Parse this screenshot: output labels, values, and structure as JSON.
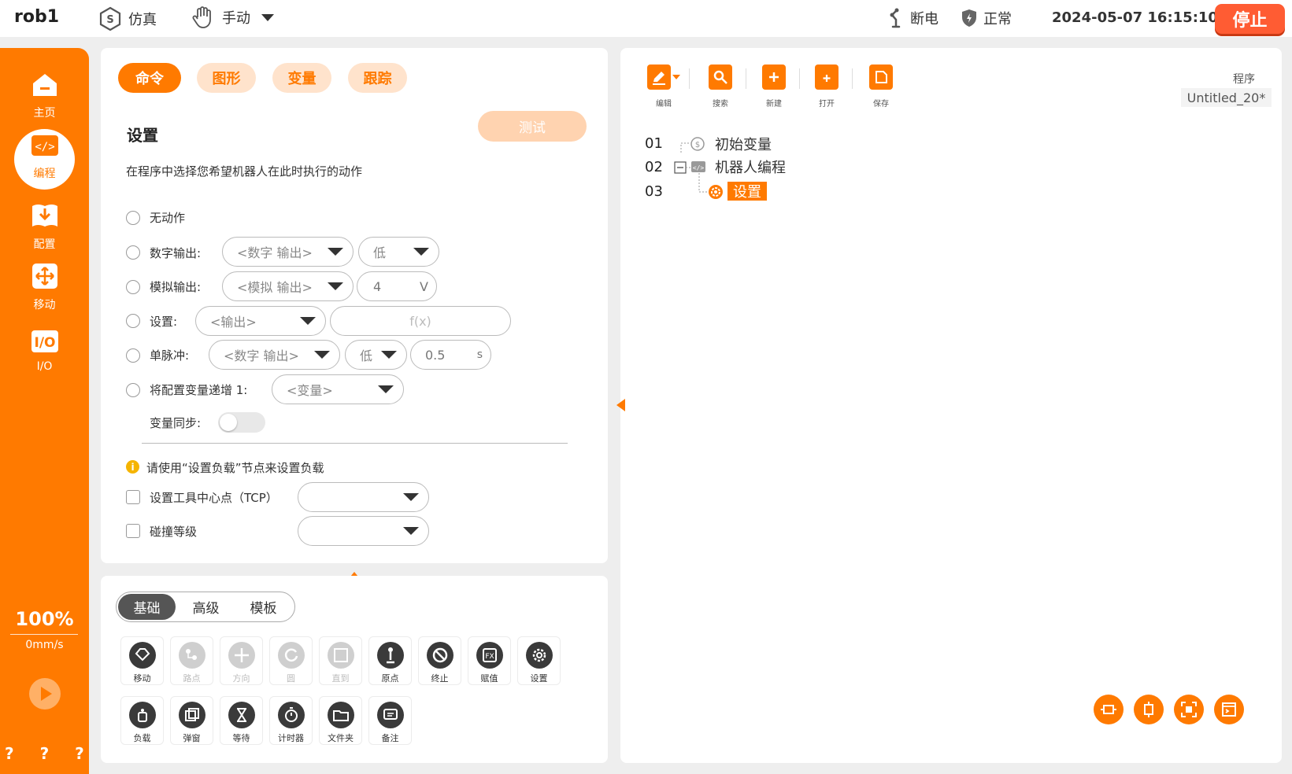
{
  "header": {
    "robot_name": "rob1",
    "mode_sim": "仿真",
    "mode_manual": "手动",
    "power": "断电",
    "status": "正常",
    "datetime": "2024-05-07 16:15:10",
    "stop": "停止"
  },
  "sidebar": {
    "items": [
      {
        "label": "主页",
        "icon": "home-icon"
      },
      {
        "label": "编程",
        "icon": "code-icon"
      },
      {
        "label": "配置",
        "icon": "install-icon"
      },
      {
        "label": "移动",
        "icon": "move-icon"
      },
      {
        "label": "I/O",
        "icon": "io-icon"
      }
    ],
    "speed_percent": "100%",
    "speed_value": "0mm/s",
    "help": "? ? ? ?"
  },
  "command": {
    "tabs": [
      "命令",
      "图形",
      "变量",
      "跟踪"
    ],
    "title": "设置",
    "test_button": "测试",
    "description": "在程序中选择您希望机器人在此时执行的动作",
    "options": {
      "no_action": "无动作",
      "digital_out": {
        "label": "数字输出:",
        "select": "<数字 输出>",
        "level": "低"
      },
      "analog_out": {
        "label": "模拟输出:",
        "select": "<模拟 输出>",
        "value": "4",
        "unit": "V"
      },
      "set": {
        "label": "设置:",
        "select": "<输出>",
        "expr": "f(x)"
      },
      "pulse": {
        "label": "单脉冲:",
        "select": "<数字 输出>",
        "level": "低",
        "value": "0.5",
        "unit": "s"
      },
      "increment": {
        "label": "将配置变量递增 1:",
        "select": "<变量>"
      },
      "var_sync": "变量同步:"
    },
    "info": "请使用“设置负载”节点来设置负载",
    "tcp_label": "设置工具中心点（TCP）",
    "collision_label": "碰撞等级"
  },
  "toolbox": {
    "segments": [
      "基础",
      "高级",
      "模板"
    ],
    "row1": [
      {
        "label": "移动",
        "icon": "move-node-icon",
        "enabled": true
      },
      {
        "label": "路点",
        "icon": "waypoint-icon",
        "enabled": false
      },
      {
        "label": "方向",
        "icon": "direction-icon",
        "enabled": false
      },
      {
        "label": "圆",
        "icon": "circle-icon",
        "enabled": false
      },
      {
        "label": "直到",
        "icon": "until-icon",
        "enabled": false
      },
      {
        "label": "原点",
        "icon": "origin-icon",
        "enabled": true
      },
      {
        "label": "终止",
        "icon": "stop-icon",
        "enabled": true
      },
      {
        "label": "赋值",
        "icon": "assign-icon",
        "enabled": true
      },
      {
        "label": "设置",
        "icon": "gear-icon",
        "enabled": true
      }
    ],
    "row2": [
      {
        "label": "负载",
        "icon": "payload-icon",
        "enabled": true
      },
      {
        "label": "弹窗",
        "icon": "popup-icon",
        "enabled": true
      },
      {
        "label": "等待",
        "icon": "hourglass-icon",
        "enabled": true
      },
      {
        "label": "计时器",
        "icon": "timer-icon",
        "enabled": true
      },
      {
        "label": "文件夹",
        "icon": "folder-icon",
        "enabled": true
      },
      {
        "label": "备注",
        "icon": "comment-icon",
        "enabled": true
      }
    ]
  },
  "program": {
    "toolbar": [
      "编辑",
      "搜索",
      "新建",
      "打开",
      "保存"
    ],
    "label": "程序",
    "name": "Untitled_20*",
    "tree": [
      {
        "line": "01",
        "label": "初始变量"
      },
      {
        "line": "02",
        "label": "机器人编程"
      },
      {
        "line": "03",
        "label": "设置"
      }
    ]
  },
  "colors": {
    "accent": "#ff7a00",
    "stop": "#ff5c33"
  }
}
